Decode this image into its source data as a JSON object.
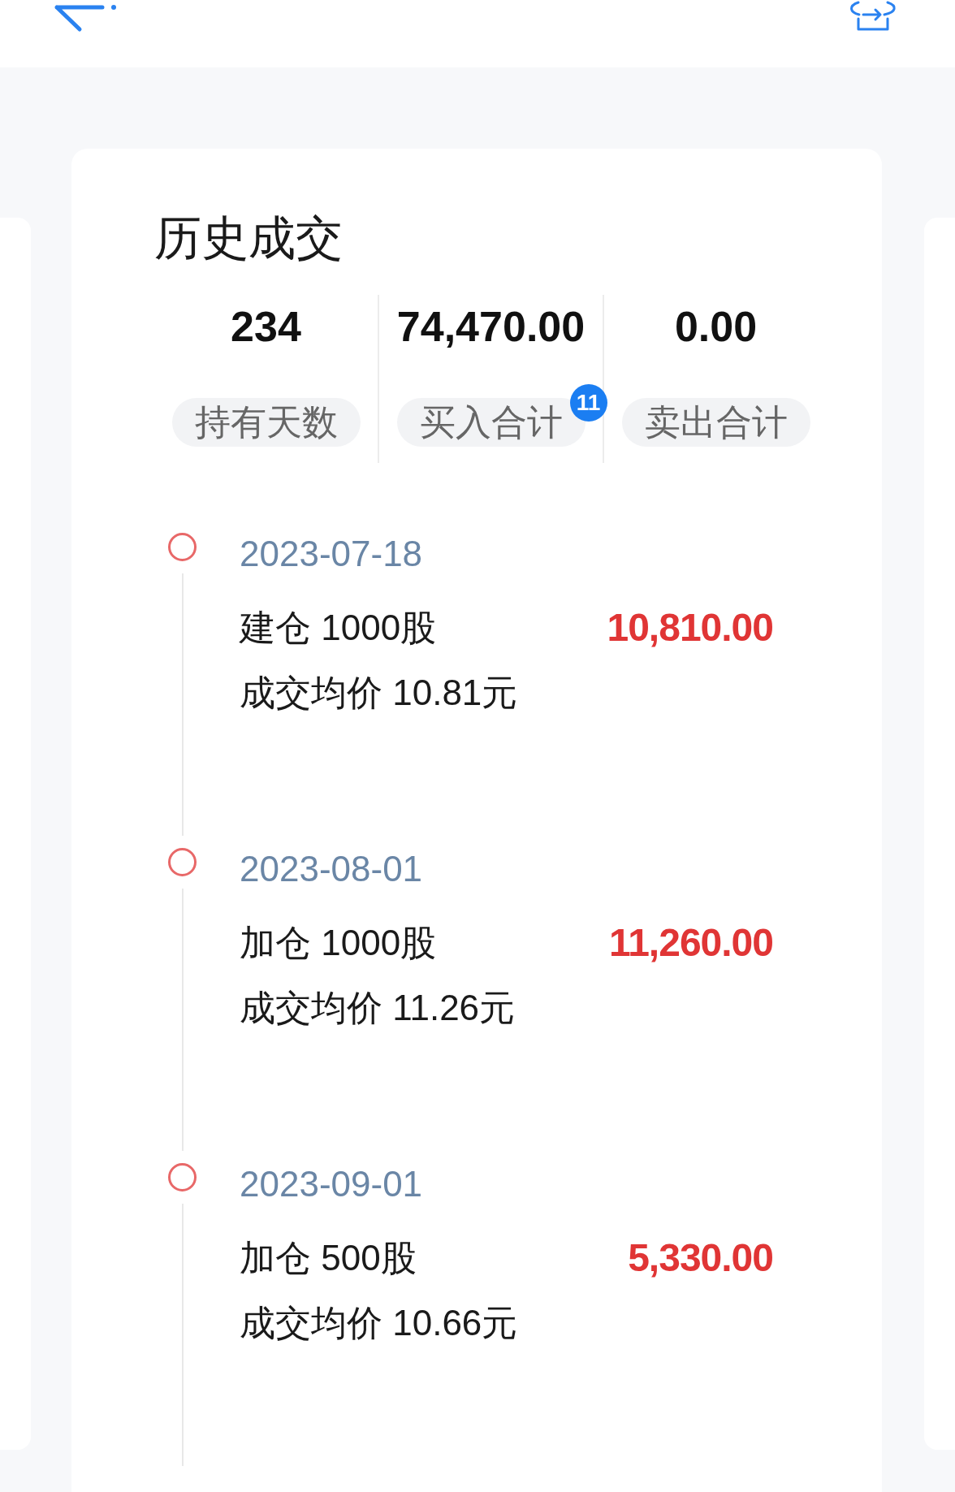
{
  "title": "历史成交",
  "stats": [
    {
      "value": "234",
      "label": "持有天数"
    },
    {
      "value": "74,470.00",
      "label": "买入合计",
      "badge": "11"
    },
    {
      "value": "0.00",
      "label": "卖出合计"
    }
  ],
  "trades": [
    {
      "date": "2023-07-18",
      "action": "建仓 1000股",
      "amount": "10,810.00",
      "avg_price": "成交均价 10.81元"
    },
    {
      "date": "2023-08-01",
      "action": "加仓 1000股",
      "amount": "11,260.00",
      "avg_price": "成交均价 11.26元"
    },
    {
      "date": "2023-09-01",
      "action": "加仓 500股",
      "amount": "5,330.00",
      "avg_price": "成交均价 10.66元"
    }
  ]
}
